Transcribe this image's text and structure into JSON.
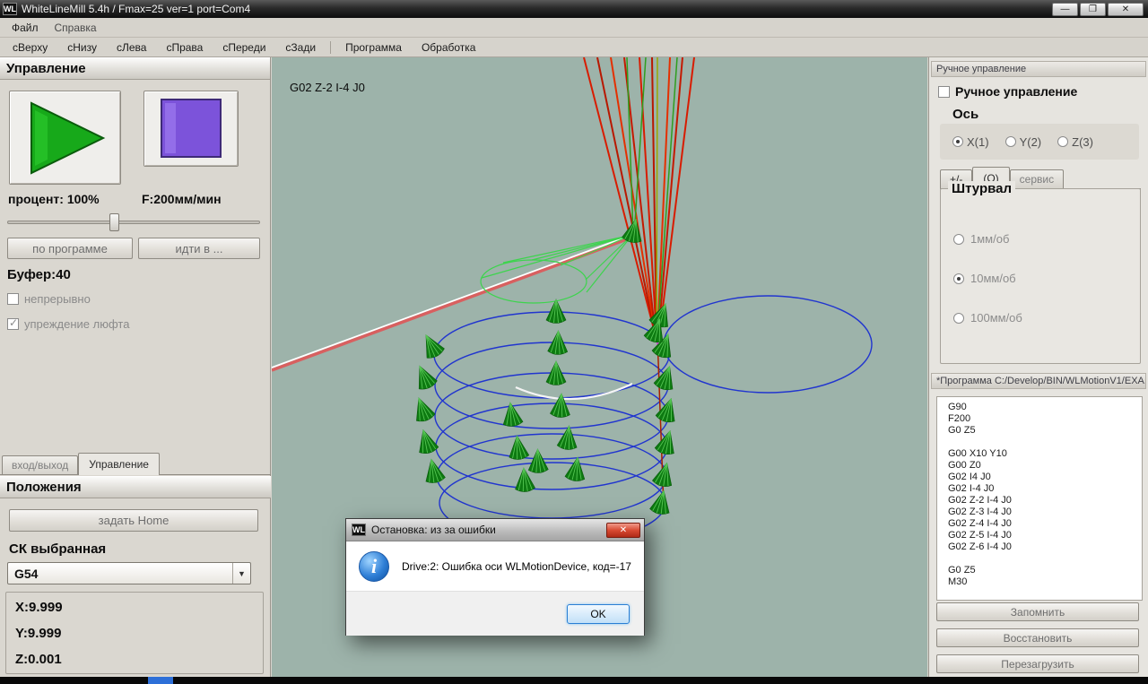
{
  "window": {
    "icon": "WL",
    "title": "WhiteLineMill 5.4h / Fmax=25 ver=1 port=Com4",
    "minimize": "—",
    "maximize": "❐",
    "close": "✕"
  },
  "menu": {
    "items": [
      "Файл",
      "Справка"
    ]
  },
  "toolbar": {
    "items": [
      "сВерху",
      "сНизу",
      "сЛева",
      "сПрава",
      "сПереди",
      "сЗади",
      "Программа",
      "Обработка"
    ]
  },
  "control": {
    "header": "Управление",
    "percent": "процент: 100%",
    "feed": "F:200мм/мин",
    "by_program": "по программе",
    "goto": "идти в ...",
    "buffer": "Буфер:40",
    "continuous": "непрерывно",
    "backlash": "упреждение люфта",
    "tab_io": "вход/выход",
    "tab_control": "Управление"
  },
  "positions": {
    "header": "Положения",
    "set_home": "задать Home",
    "cs_label": "СК выбранная",
    "cs_value": "G54",
    "combo_arrow": "▼",
    "x": "X:9.999",
    "y": "Y:9.999",
    "z": "Z:0.001"
  },
  "viewport": {
    "gcode_label": "G02 Z-2 I-4 J0"
  },
  "manual": {
    "caption": "Ручное управление",
    "checkbox": "Ручное управление",
    "axis_header": "Ось",
    "axis_x": "X(1)",
    "axis_y": "Y(2)",
    "axis_z": "Z(3)",
    "tab_plusminus": "+/-",
    "tab_o": "(О)",
    "tab_service": "сервис",
    "wheel_header": "Штурвал",
    "wheel_1": "1мм/об",
    "wheel_10": "10мм/об",
    "wheel_100": "100мм/об"
  },
  "program": {
    "caption": "*Программа C:/Develop/BIN/WLMotionV1/EXA...",
    "code": "G90\nF200\nG0 Z5\n\nG00 X10 Y10\nG00 Z0\nG02 I4 J0\nG02 I-4 J0\nG02 Z-2 I-4 J0\nG02 Z-3 I-4 J0\nG02 Z-4 I-4 J0\nG02 Z-5 I-4 J0\nG02 Z-6 I-4 J0\n\nG0 Z5\nM30",
    "save": "Запомнить",
    "restore": "Восстановить",
    "reload": "Перезагрузить"
  },
  "dialog": {
    "title": "Остановка: из за ошибки",
    "icon": "WL",
    "message": "Drive:2: Ошибка оси WLMotionDevice, код=-17",
    "ok": "OK",
    "close": "✕"
  }
}
